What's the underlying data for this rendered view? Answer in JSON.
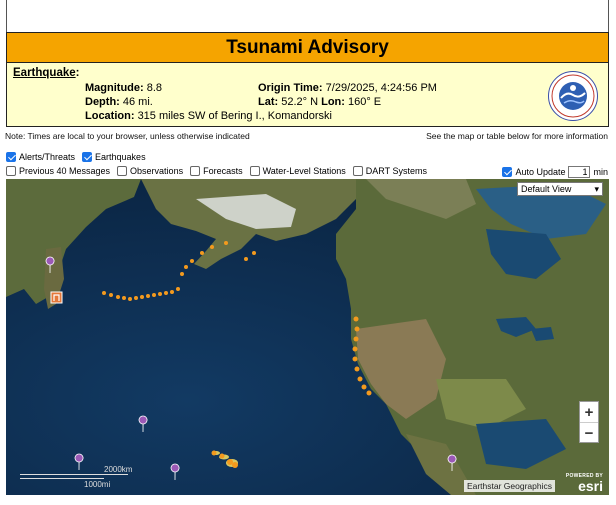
{
  "title": "Tsunami Advisory",
  "event": {
    "heading": "Earthquake",
    "magnitude_label": "Magnitude:",
    "magnitude": "8.8",
    "depth_label": "Depth:",
    "depth": "46 mi.",
    "location_label": "Location:",
    "location": "315 miles SW of Bering I., Komandorski",
    "origin_label": "Origin Time:",
    "origin_time": "7/29/2025, 4:24:56 PM",
    "lat_label": "Lat:",
    "lat": "52.2° N",
    "lon_label": "Lon:",
    "lon": "160° E"
  },
  "seal_icon": "nws-seal-icon",
  "notes": {
    "left": "Note: Times are local to your browser, unless otherwise indicated",
    "right": "See the map or table below for more information"
  },
  "layers_row1": [
    {
      "label": "Alerts/Threats",
      "checked": true
    },
    {
      "label": "Earthquakes",
      "checked": true
    }
  ],
  "layers_row2": [
    {
      "label": "Previous 40 Messages",
      "checked": false
    },
    {
      "label": "Observations",
      "checked": false
    },
    {
      "label": "Forecasts",
      "checked": false
    },
    {
      "label": "Water-Level Stations",
      "checked": false
    },
    {
      "label": "DART Systems",
      "checked": false
    }
  ],
  "auto_update": {
    "label": "Auto Update",
    "checked": true,
    "value": "1",
    "unit": "min"
  },
  "map": {
    "view_select": "Default View",
    "zoom_in": "+",
    "zoom_out": "−",
    "attribution": "Earthstar Geographics",
    "powered_by": "POWERED BY",
    "esri": "esri",
    "scale_km": "2000km",
    "scale_mi": "1000mi",
    "colors": {
      "ocean": "#0d2b4a",
      "land": "#5f6b3e",
      "alert": "#f39a1e",
      "quake": "#9b59b6"
    }
  }
}
